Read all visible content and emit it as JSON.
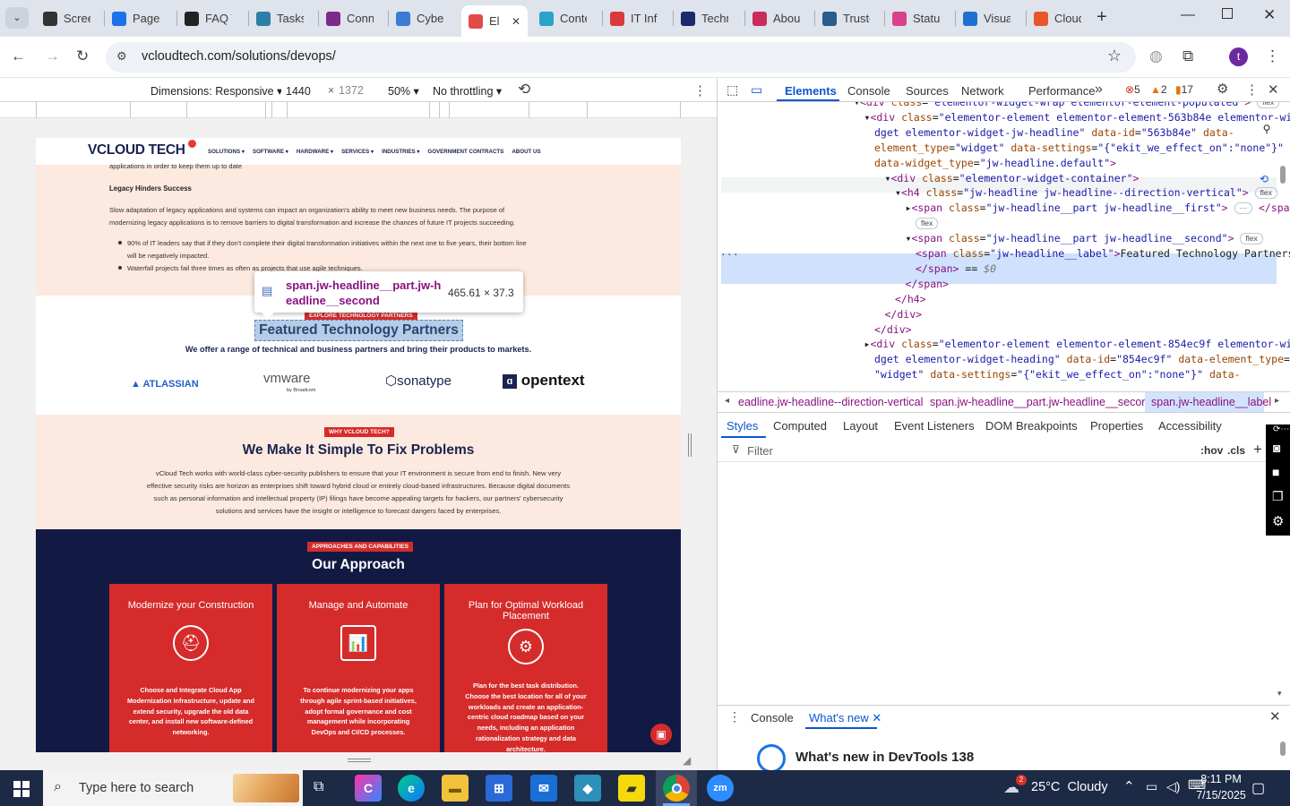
{
  "browser": {
    "tabs": [
      {
        "title": "Screen",
        "icon": "gear-icon",
        "color": "#333333"
      },
      {
        "title": "PageS",
        "icon": "pagespeed-icon",
        "color": "#1a73e8"
      },
      {
        "title": "FAQ T",
        "icon": "faq-icon",
        "color": "#222222"
      },
      {
        "title": "Tasks",
        "icon": "tasks-icon",
        "color": "#2d7ea8"
      },
      {
        "title": "Conn",
        "icon": "check-icon",
        "color": "#7d2a8a"
      },
      {
        "title": "Cyber",
        "icon": "cyber-icon",
        "color": "#3a7bd5"
      },
      {
        "title": "El",
        "icon": "elementor-icon",
        "color": "#e34b4b"
      },
      {
        "title": "Conte",
        "icon": "content-icon",
        "color": "#2aa3c9"
      },
      {
        "title": "IT Infr",
        "icon": "it-icon",
        "color": "#d93b3b"
      },
      {
        "title": "Techn",
        "icon": "x-icon",
        "color": "#1a2a6c"
      },
      {
        "title": "About",
        "icon": "about-icon",
        "color": "#c92c5a"
      },
      {
        "title": "Truste",
        "icon": "scale-icon",
        "color": "#2b5b8a"
      },
      {
        "title": "Status",
        "icon": "status-icon",
        "color": "#d9418c"
      },
      {
        "title": "Visua",
        "icon": "visual-icon",
        "color": "#1f6fd1"
      },
      {
        "title": "Cloud",
        "icon": "cloud-icon",
        "color": "#e8562a"
      }
    ],
    "active_tab_close": "✕",
    "new_tab": "+",
    "url": "vcloudtech.com/solutions/devops/",
    "profile_initial": "t"
  },
  "device_toolbar": {
    "dimensions_label": "Dimensions: Responsive",
    "width": "1440",
    "times": "×",
    "height": "1372",
    "zoom": "50%",
    "throttle": "No throttling"
  },
  "site": {
    "logo": "VCLOUD TECH",
    "nav": [
      "SOLUTIONS",
      "SOFTWARE",
      "HARDWARE",
      "SERVICES",
      "INDUSTRIES",
      "GOVERNMENT CONTRACTS",
      "ABOUT US"
    ],
    "top_cut_text": "applications in order to keep them up to date",
    "legacy_heading": "Legacy Hinders Success",
    "legacy_para_1": "Slow adaptation of legacy applications and systems can impact an organization's ability to meet new business needs. The purpose of",
    "legacy_para_2": "modernizing legacy applications is to remove barriers to digital transformation and increase the chances of future IT projects succeeding.",
    "bullet_1a": "90% of IT leaders say that if they don't complete their digital transformation initiatives within the next one to five years, their bottom line",
    "bullet_1b": "will be negatively impacted.",
    "bullet_2": "Waterfall projects fail three times as often as projects that use agile techniques.",
    "tooltip_selector_1": "span.jw-headline__part.jw-h",
    "tooltip_selector_2": "eadline__second",
    "tooltip_size": "465.61 × 37.3",
    "partners_label": "EXPLORE TECHNOLOGY PARTNERS",
    "partners_heading": "Featured Technology Partners",
    "partners_sub": "We offer a range of technical and business partners and bring their products to markets.",
    "partner_logos": [
      "ATLASSIAN",
      "vmware",
      "by Broadcom",
      "sonatype",
      "opentext"
    ],
    "why_label": "WHY VCLOUD TECH?",
    "why_heading": "We Make It Simple To Fix Problems",
    "why_para": [
      "vCloud Tech works with world-class cyber-security publishers to ensure that your IT environment is secure from end to finish. New very",
      "effective security risks are horizon as enterprises shift toward hybrid cloud or entirely cloud-based infrastructures. Because digital documents",
      "such as personal information and intellectual property (IP) filings have become appealing targets for hackers, our partners' cybersecurity",
      "solutions and services have the insight or intelligence to forecast dangers faced by enterprises."
    ],
    "approach_label": "APPROACHES AND CAPABILITIES",
    "approach_heading": "Our Approach",
    "cards": [
      {
        "title": "Modernize your Construction",
        "lines": [
          "Choose and Integrate Cloud App",
          "Modernization Infrastructure, update and",
          "extend security, upgrade the old data",
          "center, and install new software-defined",
          "networking."
        ]
      },
      {
        "title": "Manage and Automate",
        "lines": [
          "To continue modernizing your apps",
          "through agile sprint-based initiatives,",
          "adopt formal governance and cost",
          "management while incorporating",
          "DevOps and CI/CD processes."
        ]
      },
      {
        "title": "Plan for Optimal Workload Placement",
        "lines": [
          "Plan for the best task distribution.",
          "Choose the best location for all of your",
          "workloads and create an application-",
          "centric cloud roadmap based on your",
          "needs, including an application",
          "rationalization strategy and data",
          "architecture."
        ]
      }
    ]
  },
  "devtools": {
    "tabs": [
      "Elements",
      "Console",
      "Sources",
      "Network",
      "Performance"
    ],
    "more": "»",
    "errors": "5",
    "warnings": "2",
    "issues": "17",
    "dom_lines": [
      {
        "indent": 0,
        "html": "▾<span class=\"tg\">&lt;div</span> <span class=\"an\">class</span>=<span class=\"av\">\"elementor-widget-wrap elementor-element-populated\"</span><span class=\"tg\">&gt;</span> <span class=\"badge\">flex</span>"
      },
      {
        "indent": 1,
        "html": "▾<span class=\"tg\">&lt;div</span> <span class=\"an\">class</span>=<span class=\"av\">\"elementor-element elementor-element-563b84e elementor-wi</span>"
      },
      {
        "indent": 2,
        "html": "<span class=\"av\">dget elementor-widget-jw-headline\"</span> <span class=\"an\">data-id</span>=<span class=\"av\">\"563b84e\"</span> <span class=\"an\">data-</span>"
      },
      {
        "indent": 2,
        "html": "<span class=\"an\">element_type</span>=<span class=\"av\">\"widget\"</span> <span class=\"an\">data-settings</span>=<span class=\"av\">\"{\"ekit_we_effect_on\":\"none\"}\"</span>"
      },
      {
        "indent": 2,
        "html": "<span class=\"an\">data-widget_type</span>=<span class=\"av\">\"jw-headline.default\"</span><span class=\"tg\">&gt;</span>"
      },
      {
        "indent": 3,
        "html": "▾<span class=\"tg\">&lt;div</span> <span class=\"an\">class</span>=<span class=\"av\">\"elementor-widget-container\"</span><span class=\"tg\">&gt;</span>"
      },
      {
        "indent": 4,
        "html": "▾<span class=\"tg\">&lt;h4</span> <span class=\"an\">class</span>=<span class=\"av\">\"jw-headline jw-headline--direction-vertical\"</span><span class=\"tg\">&gt;</span> <span class=\"badge\">flex</span>"
      },
      {
        "indent": 5,
        "html": "▸<span class=\"tg\">&lt;span</span> <span class=\"an\">class</span>=<span class=\"av\">\"jw-headline__part jw-headline__first\"</span><span class=\"tg\">&gt;</span> <span class=\"badge\">···</span> <span class=\"tg\">&lt;/span&gt;</span>"
      },
      {
        "indent": 6,
        "html": "<span class=\"badge\">flex</span>"
      },
      {
        "indent": 5,
        "html": "▾<span class=\"tg\">&lt;span</span> <span class=\"an\">class</span>=<span class=\"av\">\"jw-headline__part jw-headline__second\"</span><span class=\"tg\">&gt;</span> <span class=\"badge\">flex</span>"
      },
      {
        "indent": 6,
        "html": "<span class=\"tg\">&lt;span</span> <span class=\"an\">class</span>=<span class=\"av\">\"jw-headline__label\"</span><span class=\"tg\">&gt;</span>Featured Technology Partners"
      },
      {
        "indent": 6,
        "html": "<span class=\"tg\">&lt;/span&gt;</span> == <i style=\"color:#777\">$0</i>"
      },
      {
        "indent": 5,
        "html": "<span class=\"tg\">&lt;/span&gt;</span>"
      },
      {
        "indent": 4,
        "html": "<span class=\"tg\">&lt;/h4&gt;</span>"
      },
      {
        "indent": 3,
        "html": "<span class=\"tg\">&lt;/div&gt;</span>"
      },
      {
        "indent": 2,
        "html": "<span class=\"tg\">&lt;/div&gt;</span>"
      },
      {
        "indent": 1,
        "html": "▸<span class=\"tg\">&lt;div</span> <span class=\"an\">class</span>=<span class=\"av\">\"elementor-element elementor-element-854ec9f elementor-wi</span>"
      },
      {
        "indent": 2,
        "html": "<span class=\"av\">dget elementor-widget-heading\"</span> <span class=\"an\">data-id</span>=<span class=\"av\">\"854ec9f\"</span> <span class=\"an\">data-element_type</span>="
      },
      {
        "indent": 2,
        "html": "<span class=\"av\">\"widget\"</span> <span class=\"an\">data-settings</span>=<span class=\"av\">\"{\"ekit_we_effect_on\":\"none\"}\"</span> <span class=\"an\">data-</span>"
      }
    ],
    "breadcrumbs": [
      "eadline.jw-headline--direction-vertical",
      "span.jw-headline__part.jw-headline__second",
      "span.jw-headline__label"
    ],
    "style_tabs": [
      "Styles",
      "Computed",
      "Layout",
      "Event Listeners",
      "DOM Breakpoints",
      "Properties",
      "Accessibility"
    ],
    "filter_placeholder": "Filter",
    "hov": ":hov",
    "cls": ".cls",
    "drawer_tabs": [
      "Console",
      "What's new"
    ],
    "whats_new": "What's new in DevTools 138"
  },
  "taskbar": {
    "search_placeholder": "Type here to search",
    "weather_badge": "2",
    "weather": "25°C  Cloudy",
    "time": "8:11 PM",
    "date": "7/15/2025"
  },
  "colors": {
    "accent_blue": "#0b57d0",
    "brand_red": "#d52b2b",
    "navy": "#121a44",
    "peach": "#fce9df"
  }
}
